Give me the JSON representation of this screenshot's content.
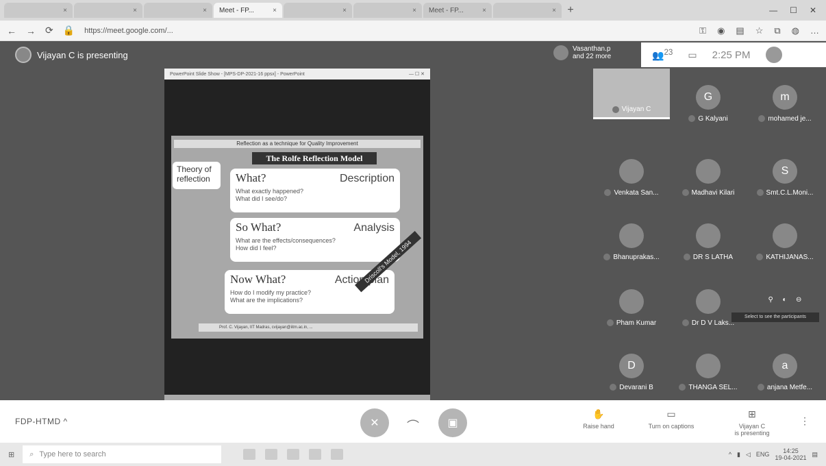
{
  "browser": {
    "tabs": [
      {
        "label": "",
        "active": false
      },
      {
        "label": "",
        "active": false
      },
      {
        "label": "",
        "active": false
      },
      {
        "label": "Meet - FP...",
        "active": true
      },
      {
        "label": "",
        "active": false
      },
      {
        "label": "",
        "active": false
      },
      {
        "label": "Meet - FP...",
        "active": false
      },
      {
        "label": "",
        "active": false
      }
    ],
    "url": "https://meet.google.com/...",
    "new_tab": "+"
  },
  "presenter": {
    "text": "Vijayan C is presenting"
  },
  "shared_window": {
    "title": "PowerPoint Slide Show - [MPS-DP-2021-16 ppsx] - PowerPoint"
  },
  "slide": {
    "header": "Reflection as a technique for Quality Improvement",
    "model_title": "The Rolfe Reflection Model",
    "theory_box": "Theory of reflection",
    "cards": [
      {
        "q": "What?",
        "label": "Description",
        "l1": "What exactly happened?",
        "l2": "What did I see/do?"
      },
      {
        "q": "So What?",
        "label": "Analysis",
        "l1": "What are the effects/consequences?",
        "l2": "How did I feel?"
      },
      {
        "q": "Now What?",
        "label": "Action plan",
        "l1": "How do I modify my practice?",
        "l2": "What are the implications?"
      }
    ],
    "ribbon": "Driscoll's Model, 1994",
    "footer": "Prof. C. Vijayan, IIT Madras, cvijayan@iitm.ac.in, ..."
  },
  "meeting_info": {
    "host": "Vasanthan.p",
    "others": "and 22 more",
    "participants_badge": "23",
    "time": "2:25 PM"
  },
  "participants": [
    {
      "name": "Vijayan C",
      "initial": "",
      "video": true
    },
    {
      "name": "G Kalyani",
      "initial": "G",
      "video": false
    },
    {
      "name": "mohamed je...",
      "initial": "m",
      "video": false
    },
    {
      "name": "Venkata San...",
      "initial": "",
      "video": false
    },
    {
      "name": "Madhavi Kilari",
      "initial": "",
      "video": false
    },
    {
      "name": "Smt.C.L.Moni...",
      "initial": "S",
      "video": false
    },
    {
      "name": "Bhanuprakas...",
      "initial": "",
      "video": false
    },
    {
      "name": "DR S LATHA",
      "initial": "",
      "video": false
    },
    {
      "name": "KATHIJANAS...",
      "initial": "",
      "video": false
    },
    {
      "name": "Pham Kumar",
      "initial": "",
      "video": false
    },
    {
      "name": "Dr D V Laks...",
      "initial": "",
      "video": false
    },
    {
      "name": "",
      "initial": "",
      "video": false
    },
    {
      "name": "Devarani B",
      "initial": "D",
      "video": false
    },
    {
      "name": "THANGA SEL...",
      "initial": "",
      "video": false
    },
    {
      "name": "anjana Metfe...",
      "initial": "a",
      "video": false
    }
  ],
  "tooltip": "Select to see the participants",
  "controls": {
    "meeting_name": "FDP-HTMD",
    "raise_hand": "Raise hand",
    "captions": "Turn on captions",
    "presenting_line1": "Vijayan C",
    "presenting_line2": "is presenting",
    "more": "⋮"
  },
  "taskbar": {
    "search_placeholder": "Type here to search",
    "clock_time": "14:25",
    "clock_date": "19-04-2021",
    "lang": "ENG"
  }
}
